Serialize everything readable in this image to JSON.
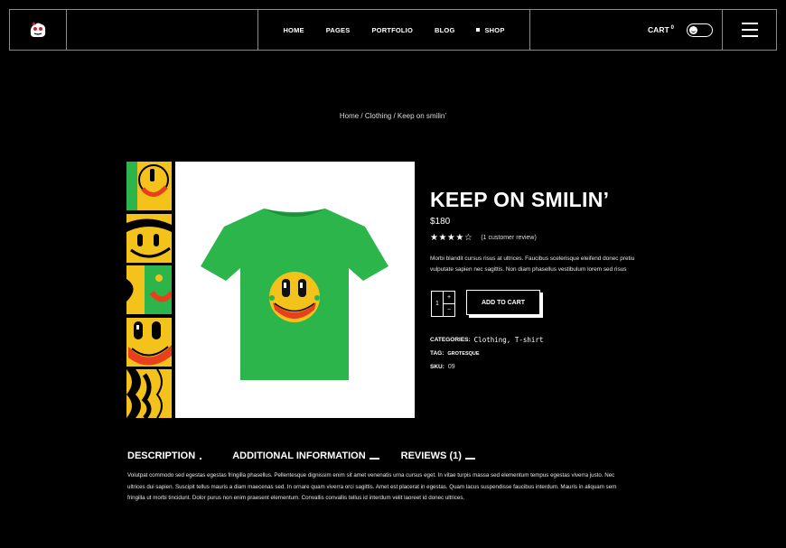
{
  "header": {
    "nav": [
      {
        "label": "HOME"
      },
      {
        "label": "PAGES"
      },
      {
        "label": "PORTFOLIO"
      },
      {
        "label": "BLOG"
      },
      {
        "label": "SHOP"
      }
    ],
    "cart_label": "CART",
    "cart_count": "0"
  },
  "breadcrumb": {
    "home": "Home",
    "sep1": " / ",
    "category": "Clothing",
    "sep2": " / ",
    "current": "Keep on smilin’"
  },
  "product": {
    "title": "KEEP ON SMILIN’",
    "price": "$180",
    "stars": "★★★★☆",
    "rating_value": 4,
    "reviews_text": "(1 customer review)",
    "short_description": "Morbi blandit cursus risus at ultrices. Faucibus scelerisque eleifend donec pretiu vulputate sapien nec sagittis. Non diam phasellus vestibulum lorem sed risus",
    "quantity": "1",
    "qty_plus": "+",
    "qty_minus": "−",
    "add_to_cart": "ADD TO CART",
    "categories_label": "CATEGORIES:",
    "categories_value": "Clothing, T-shirt",
    "tag_label": "TAG:",
    "tag_value": "GROTESQUE",
    "sku_label": "SKU:",
    "sku_value": "09",
    "shirt_color": "#2bb54b"
  },
  "tabs": [
    {
      "label": "DESCRIPTION"
    },
    {
      "label": "ADDITIONAL INFORMATION"
    },
    {
      "label": "REVIEWS (1)"
    }
  ],
  "description": "Volutpat commodo sed egestas egestas fringilla phasellus. Pellentesque dignissim enim sit amet venenatis urna cursus eget. In vitae turpis massa sed elementum tempus egestas viverra justo. Nec ultrices dui sapien. Suscipit tellus mauris a diam maecenas sed. In ornare quam viverra orci sagittis. Amet est placerat in egestas. Quam lacus suspendisse faucibus interdum. Mauris in aliquam sem fringilla ut morbi tincidunt. Dolor purus non enim praesent elementum. Convallis convallis tellus id interdum velit laoreet id donec ultrices."
}
